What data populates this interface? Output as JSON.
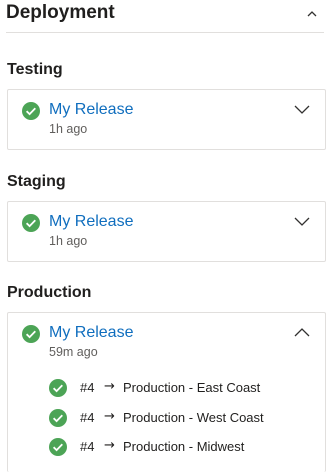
{
  "header": {
    "title": "Deployment",
    "collapse_icon": "chevron-up-icon"
  },
  "stages": [
    {
      "title": "Testing",
      "release": "My Release",
      "time": "1h ago",
      "status": "succeeded",
      "expanded": false
    },
    {
      "title": "Staging",
      "release": "My Release",
      "time": "1h ago",
      "status": "succeeded",
      "expanded": false
    },
    {
      "title": "Production",
      "release": "My Release",
      "time": "59m ago",
      "status": "succeeded",
      "expanded": true,
      "environments": [
        {
          "run": "#4",
          "arrow": "→",
          "name": "Production - East Coast",
          "status": "succeeded"
        },
        {
          "run": "#4",
          "arrow": "→",
          "name": "Production - West Coast",
          "status": "succeeded"
        },
        {
          "run": "#4",
          "arrow": "→",
          "name": "Production - Midwest",
          "status": "succeeded"
        }
      ]
    }
  ],
  "colors": {
    "success": "#4ca456",
    "link": "#106ebe",
    "border": "#e1dfdd",
    "secondary_text": "#605e5c"
  }
}
